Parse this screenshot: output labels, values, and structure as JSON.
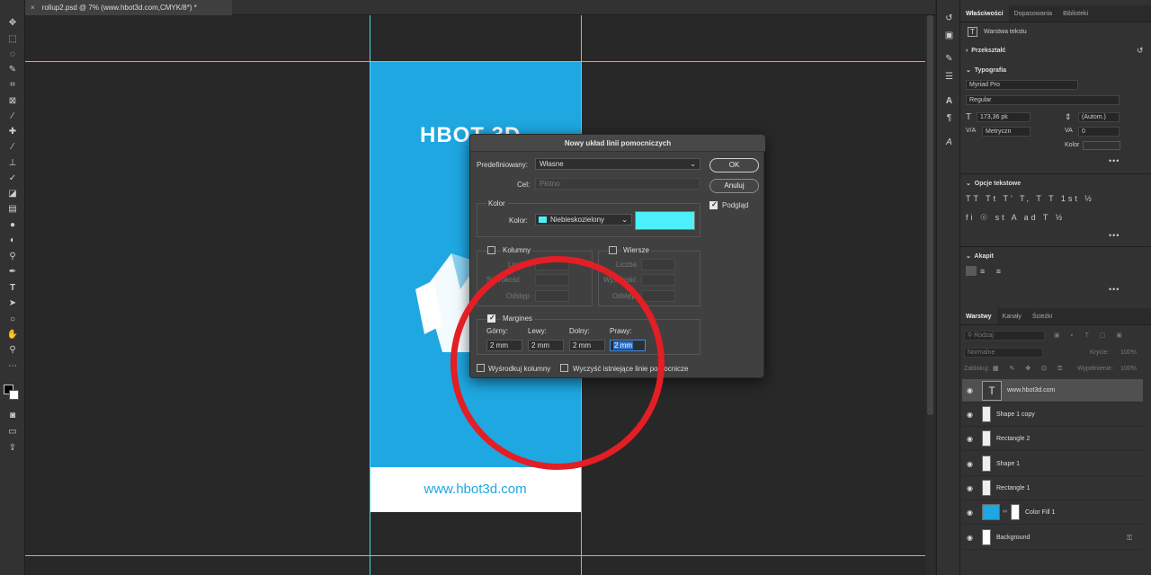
{
  "document_tab": {
    "close": "×",
    "title": "rollup2.psd @ 7% (www.hbot3d.com,CMYK/8*) *"
  },
  "canvas": {
    "logo_text": "HBOT 3D",
    "url_text": "www.hbot3d.com",
    "accent": "#1ea7e1"
  },
  "properties": {
    "tabs": [
      "Właściwości",
      "Dopasowania",
      "Biblioteki"
    ],
    "layer_type": "Warstwa tekstu",
    "transform": "Przekształć",
    "typography": "Typografia",
    "font": "Myriad Pro",
    "style": "Regular",
    "size": "173,36 pk",
    "leading": "(Autom.)",
    "kerning": "Metryczn",
    "tracking": "0",
    "color_label": "Kolor",
    "text_options": "Opcje tekstowe",
    "paragraph": "Akapit",
    "more": "•••",
    "text_color": "#2bb0e6"
  },
  "layers_panel": {
    "tabs": [
      "Warstwy",
      "Kanały",
      "Ścieżki"
    ],
    "filter_placeholder": "Rodzaj",
    "blend_mode": "Normalne",
    "opacity_label": "Krycie:",
    "opacity": "100%",
    "lock_label": "Zablokuj:",
    "fill_label": "Wypełnienie:",
    "fill": "100%",
    "layers": [
      {
        "name": "www.hbot3d.com"
      },
      {
        "name": "Shape 1 copy"
      },
      {
        "name": "Rectangle 2"
      },
      {
        "name": "Shape 1"
      },
      {
        "name": "Rectangle 1"
      },
      {
        "name": "Color Fill 1"
      },
      {
        "name": "Background"
      }
    ]
  },
  "dialog": {
    "title": "Nowy układ linii pomocniczych",
    "preset_label": "Predefiniowany:",
    "preset_value": "Własne",
    "target_label": "Cel:",
    "target_value": "Płótno",
    "ok": "OK",
    "cancel": "Anuluj",
    "preview": "Podgląd",
    "color_group": "Kolor",
    "color_label": "Kolor:",
    "color_value": "Niebieskozielony",
    "swatch": "#4cf0fa",
    "columns": "Kolumny",
    "rows": "Wiersze",
    "count": "Liczba",
    "width": "Szerokość",
    "height": "Wysokość",
    "gutter": "Odstęp",
    "margins": "Margines",
    "top": "Górny:",
    "left": "Lewy:",
    "bottom": "Dolny:",
    "right": "Prawy:",
    "top_val": "2 mm",
    "left_val": "2 mm",
    "bottom_val": "2 mm",
    "right_val": "2 mm",
    "center_columns": "Wyśrodkuj kolumny",
    "clear_guides": "Wyczyść istniejące linie pomocnicze"
  }
}
